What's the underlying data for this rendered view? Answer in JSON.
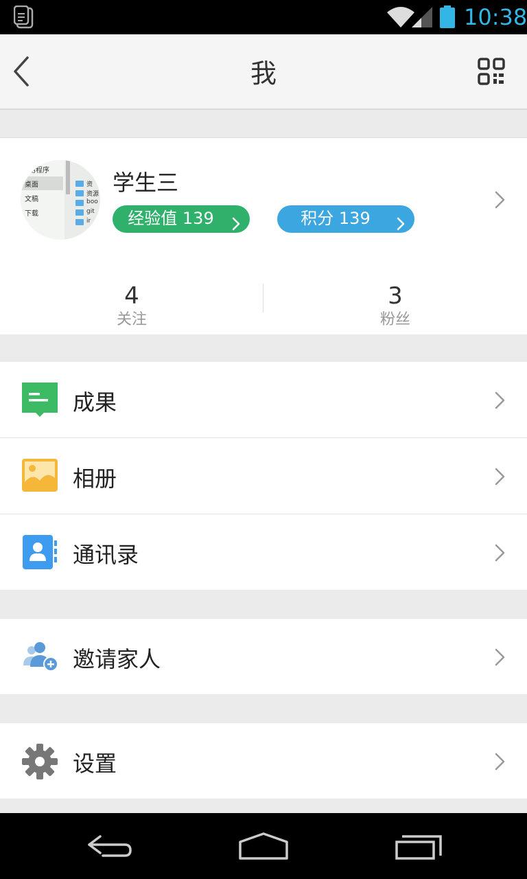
{
  "status_bar": {
    "time": "10:38",
    "icons": [
      "notification-icon",
      "wifi-icon",
      "cell-signal-icon",
      "battery-icon"
    ]
  },
  "header": {
    "title": "我",
    "back_icon": "back-chevron-icon",
    "qr_icon": "qr-code-icon"
  },
  "profile": {
    "avatar_lines": [
      "用程序",
      "桌面",
      "文稿",
      "下载"
    ],
    "avatar_files": [
      "资",
      "资源",
      "boo",
      "git",
      "ir"
    ],
    "name": "学生三",
    "experience_badge": "经验值 139",
    "points_badge": "积分 139",
    "colors": {
      "experience": "#2fb06b",
      "points": "#3ba6df"
    }
  },
  "stats": [
    {
      "value": "4",
      "label": "关注"
    },
    {
      "value": "3",
      "label": "粉丝"
    }
  ],
  "menu": {
    "achievements": "成果",
    "album": "相册",
    "contacts": "通讯录",
    "invite_family": "邀请家人",
    "settings": "设置"
  },
  "nav_bar": {
    "icons": [
      "back-icon",
      "home-icon",
      "recent-apps-icon"
    ]
  }
}
